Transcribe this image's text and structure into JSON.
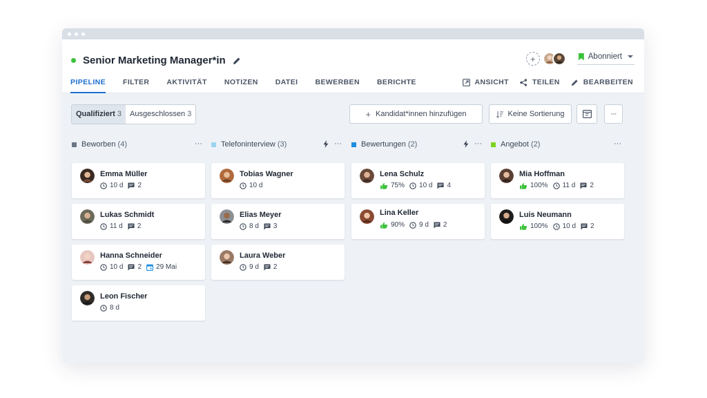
{
  "job": {
    "title": "Senior Marketing Manager*in",
    "subscribe_label": "Abonniert"
  },
  "tabs": [
    "PIPELINE",
    "FILTER",
    "AKTIVITÄT",
    "NOTIZEN",
    "DATEI",
    "BEWERBEN",
    "BERICHTE"
  ],
  "actions": {
    "view": "ANSICHT",
    "share": "TEILEN",
    "edit": "BEARBEITEN"
  },
  "segments": [
    {
      "label": "Qualifiziert",
      "count": "3"
    },
    {
      "label": "Ausgeschlossen",
      "count": "3"
    }
  ],
  "toolbar": {
    "add_candidate": "Kandidat*innen hinzufügen",
    "sorting": "Keine Sortierung",
    "more": "···"
  },
  "columns": [
    {
      "title": "Beworben",
      "count": "(4)",
      "color": "#6b7685",
      "cards": [
        {
          "name": "Emma Müller",
          "days": "10 d",
          "comments": "2"
        },
        {
          "name": "Lukas Schmidt",
          "days": "11 d",
          "comments": "2"
        },
        {
          "name": "Hanna Schneider",
          "days": "10 d",
          "comments": "2",
          "date": "29 Mai"
        },
        {
          "name": "Leon Fischer",
          "days": "8 d"
        }
      ]
    },
    {
      "title": "Telefoninterview",
      "count": "(3)",
      "color": "#9dd4f2",
      "cards": [
        {
          "name": "Tobias Wagner",
          "days": "10 d"
        },
        {
          "name": "Elias Meyer",
          "days": "8 d",
          "comments": "3"
        },
        {
          "name": "Laura Weber",
          "days": "9 d",
          "comments": "2"
        }
      ]
    },
    {
      "title": "Bewertungen",
      "count": "(2)",
      "color": "#1d8fe0",
      "cards": [
        {
          "name": "Lena Schulz",
          "score": "75%",
          "days": "10 d",
          "comments": "4"
        },
        {
          "name": "Lina Keller",
          "score": "90%",
          "days": "9 d",
          "comments": "2"
        }
      ]
    },
    {
      "title": "Angebot",
      "count": "(2)",
      "color": "#7ed321",
      "cards": [
        {
          "name": "Mia Hoffman",
          "score": "100%",
          "days": "11 d",
          "comments": "2"
        },
        {
          "name": "Luis Neumann",
          "score": "100%",
          "days": "10 d",
          "comments": "2"
        }
      ]
    }
  ]
}
